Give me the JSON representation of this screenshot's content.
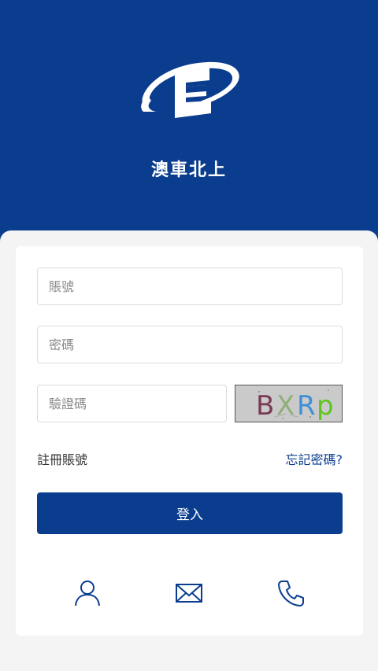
{
  "header": {
    "title": "澳車北上",
    "logo_icon": "app-logo-icon",
    "background_color": "#0b3d8e"
  },
  "form": {
    "account_placeholder": "賬號",
    "password_placeholder": "密碼",
    "captcha_placeholder": "驗證碼",
    "captcha_text": "BXRp",
    "captcha_chars": [
      {
        "char": "B",
        "color": "#7a3a55"
      },
      {
        "char": "X",
        "color": "#8fae78"
      },
      {
        "char": "R",
        "color": "#3f8fd8"
      },
      {
        "char": "p",
        "color": "#5cc61e"
      }
    ]
  },
  "links": {
    "register": "註冊賬號",
    "forgot": "忘記密碼?"
  },
  "actions": {
    "login_label": "登入"
  },
  "bottom_icons": [
    "user-icon",
    "mail-icon",
    "phone-icon"
  ],
  "colors": {
    "primary": "#0b3d8e",
    "sheet_bg": "#f4f4f4",
    "card_bg": "#ffffff"
  }
}
